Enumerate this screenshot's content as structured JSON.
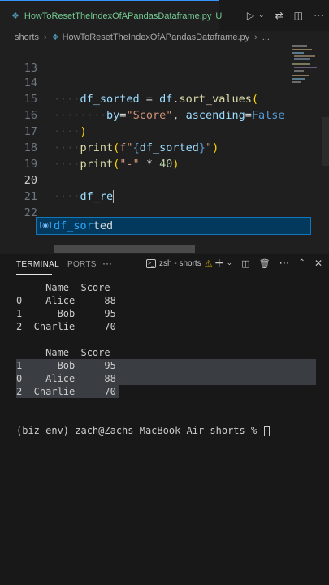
{
  "tab": {
    "file_icon": "python-file-icon",
    "filename": "HowToResetTheIndexOfAPandasDataframe.py",
    "status": "U"
  },
  "tab_actions": [
    "run-icon",
    "chevron-down-icon",
    "compare-changes-icon",
    "split-editor-icon",
    "more-icon"
  ],
  "breadcrumb": {
    "folder": "shorts",
    "file": "HowToResetTheIndexOfAPandasDataframe.py",
    "tail": "..."
  },
  "editor": {
    "line_numbers": [
      "13",
      "14",
      "15",
      "16",
      "17",
      "18",
      "19",
      "20",
      "21",
      "22"
    ],
    "active_line": "20",
    "line14": {
      "var": "df_sorted",
      "op": " = ",
      "obj": "df",
      "dot": ".",
      "fn": "sort_values",
      "paren": "("
    },
    "line15": {
      "kw1": "by",
      "eq1": "=",
      "str1": "\"Score\"",
      "comma": ", ",
      "kw2": "ascending",
      "eq2": "=",
      "val": "False"
    },
    "line16": {
      "paren": ")"
    },
    "line17": {
      "fn": "print",
      "open": "(",
      "fprefix": "f\"",
      "brace_open": "{",
      "var": "df_sorted",
      "brace_close": "}",
      "fsuffix": "\"",
      "close": ")"
    },
    "line18": {
      "fn": "print",
      "open": "(",
      "str": "\"-\"",
      "op": " * ",
      "num": "40",
      "close": ")"
    },
    "line20": {
      "typed": "df_re"
    },
    "suggestion": {
      "match": "df_sor",
      "rest": "ted",
      "kind_icon": "variable-icon"
    }
  },
  "panel": {
    "tabs": [
      "TERMINAL",
      "PORTS"
    ],
    "active_tab": "TERMINAL",
    "more": "···",
    "shell_label": "zsh - shorts",
    "actions": [
      "plus-icon",
      "chevron-down-icon",
      "split-terminal-icon",
      "trash-icon",
      "more-icon",
      "chevron-up-icon",
      "close-icon"
    ]
  },
  "terminal": {
    "lines": [
      "     Name  Score",
      "0    Alice     88",
      "1      Bob     95",
      "2  Charlie     70",
      "----------------------------------------",
      "",
      "     Name  Score",
      "1      Bob     95",
      "0    Alice     88",
      "2  Charlie     70",
      "----------------------------------------",
      "----------------------------------------",
      "(biz_env) zach@Zachs-MacBook-Air shorts % "
    ]
  },
  "colors": {
    "editor_bg": "#1f1f1f",
    "panel_bg": "#181818",
    "accent": "#3794ff",
    "git_untracked": "#73c991",
    "suggest_bg": "#04395e"
  }
}
